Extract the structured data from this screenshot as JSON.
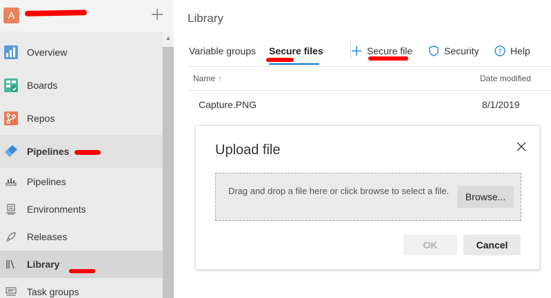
{
  "colors": {
    "accent": "#0078d4",
    "redact": "#ff0000",
    "avatar": "#e8825b"
  },
  "sidebar": {
    "avatar_letter": "A",
    "org_name": "",
    "add_icon": "plus-icon",
    "items": [
      {
        "label": "Overview",
        "icon": "overview-icon"
      },
      {
        "label": "Boards",
        "icon": "boards-icon"
      },
      {
        "label": "Repos",
        "icon": "repos-icon"
      },
      {
        "label": "Pipelines",
        "icon": "pipelines-icon"
      },
      {
        "label": "Pipelines",
        "icon": "pipelines-sub-icon"
      },
      {
        "label": "Environments",
        "icon": "environments-icon"
      },
      {
        "label": "Releases",
        "icon": "rocket-icon"
      },
      {
        "label": "Library",
        "icon": "library-icon"
      },
      {
        "label": "Task groups",
        "icon": "task-groups-icon"
      }
    ]
  },
  "main": {
    "title": "Library",
    "tabs": [
      {
        "label": "Variable groups"
      },
      {
        "label": "Secure files"
      }
    ],
    "commands": [
      {
        "label": "Secure file",
        "icon": "plus-icon"
      },
      {
        "label": "Security",
        "icon": "shield-icon"
      },
      {
        "label": "Help",
        "icon": "help-icon"
      }
    ],
    "table": {
      "columns": [
        {
          "label": "Name",
          "sort": "↑"
        },
        {
          "label": "Date modified"
        }
      ],
      "rows": [
        {
          "name": "Capture.PNG",
          "date": "8/1/2019"
        }
      ]
    }
  },
  "dialog": {
    "title": "Upload file",
    "dropzone_text": "Drag and drop a file here or click browse to select a file.",
    "browse_label": "Browse...",
    "ok_label": "OK",
    "cancel_label": "Cancel"
  }
}
